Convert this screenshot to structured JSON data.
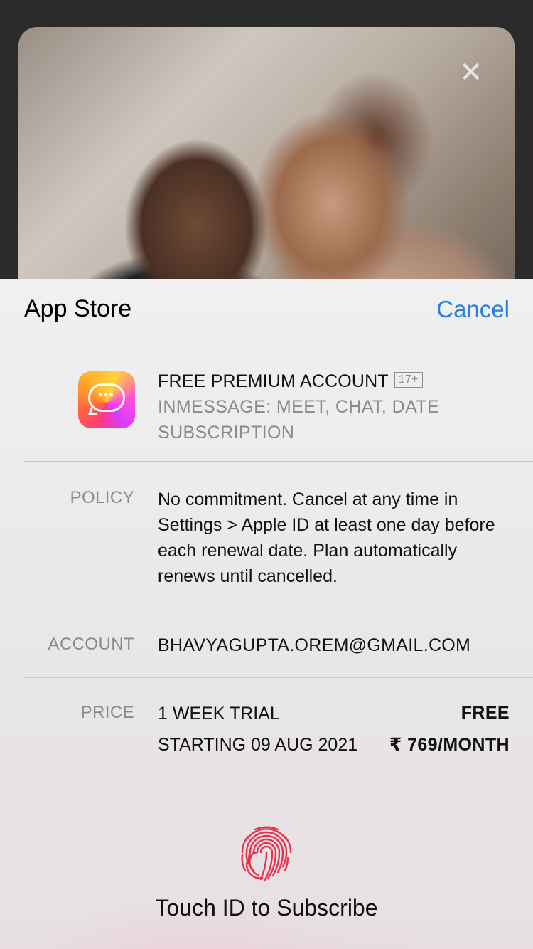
{
  "background": {
    "close_glyph": "✕"
  },
  "sheet": {
    "title": "App Store",
    "cancel_label": "Cancel"
  },
  "app": {
    "name": "FREE PREMIUM ACCOUNT",
    "age_rating": "17+",
    "subtitle_line1": "INMESSAGE: MEET, CHAT, DATE",
    "subtitle_line2": "SUBSCRIPTION",
    "icon": "chat-bubble-icon",
    "icon_dots": "•••"
  },
  "policy": {
    "label": "POLICY",
    "text": "No commitment. Cancel at any time in Settings > Apple ID at least one day before each renewal date. Plan automatically renews until cancelled."
  },
  "account": {
    "label": "ACCOUNT",
    "value": "BHAVYAGUPTA.OREM@GMAIL.COM"
  },
  "price": {
    "label": "PRICE",
    "trial": "1 WEEK TRIAL",
    "trial_price": "FREE",
    "starting": "STARTING 09 AUG 2021",
    "monthly_price": "₹ 769/MONTH"
  },
  "touch_id": {
    "label": "Touch ID to Subscribe",
    "icon": "fingerprint-icon"
  },
  "colors": {
    "accent": "#2a7de1",
    "fingerprint": "#e8334f"
  }
}
